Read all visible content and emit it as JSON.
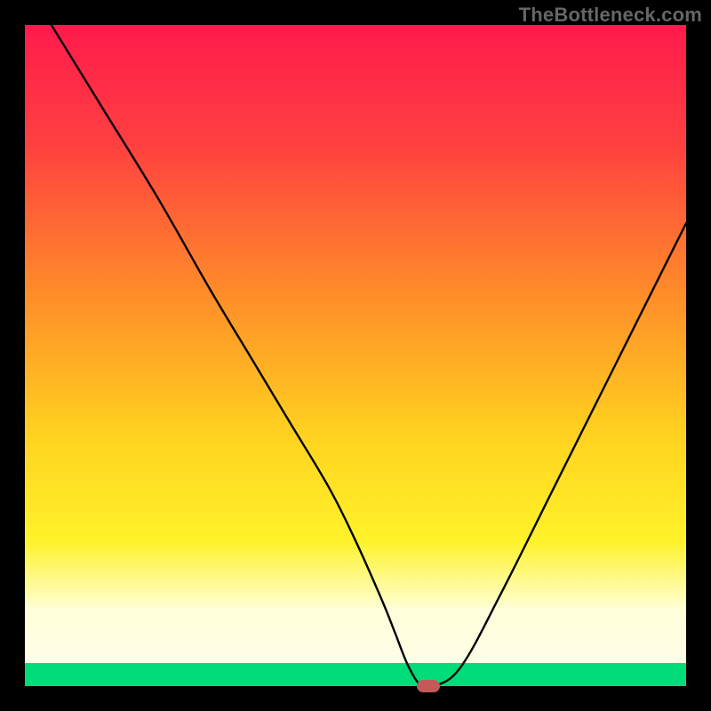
{
  "watermark": "TheBottleneck.com",
  "chart_data": {
    "type": "line",
    "title": "",
    "xlabel": "",
    "ylabel": "",
    "xlim": [
      0,
      100
    ],
    "ylim": [
      0,
      100
    ],
    "series": [
      {
        "name": "bottleneck-curve",
        "x": [
          4,
          12,
          20,
          28,
          34,
          40,
          46,
          50,
          54,
          56,
          58,
          60,
          62,
          66,
          72,
          80,
          88,
          96,
          100
        ],
        "y": [
          100,
          87,
          74,
          60,
          50,
          40,
          30,
          22,
          13,
          8,
          3,
          0,
          0,
          3,
          14,
          30,
          46,
          62,
          70
        ]
      }
    ],
    "marker": {
      "x": 61,
      "y": 0
    },
    "green_band": {
      "y_from": 0,
      "y_to": 3.5
    },
    "pale_band": {
      "y_from": 3.5,
      "y_to": 12
    },
    "gradient_stops": [
      {
        "offset": 0.0,
        "color": "#ff1a4d"
      },
      {
        "offset": 0.18,
        "color": "#ff4040"
      },
      {
        "offset": 0.4,
        "color": "#ff8a2a"
      },
      {
        "offset": 0.62,
        "color": "#ffd21f"
      },
      {
        "offset": 0.78,
        "color": "#fff22a"
      },
      {
        "offset": 0.88,
        "color": "#fffecf"
      },
      {
        "offset": 0.965,
        "color": "#fffef0"
      },
      {
        "offset": 1.0,
        "color": "#00e07a"
      }
    ]
  }
}
